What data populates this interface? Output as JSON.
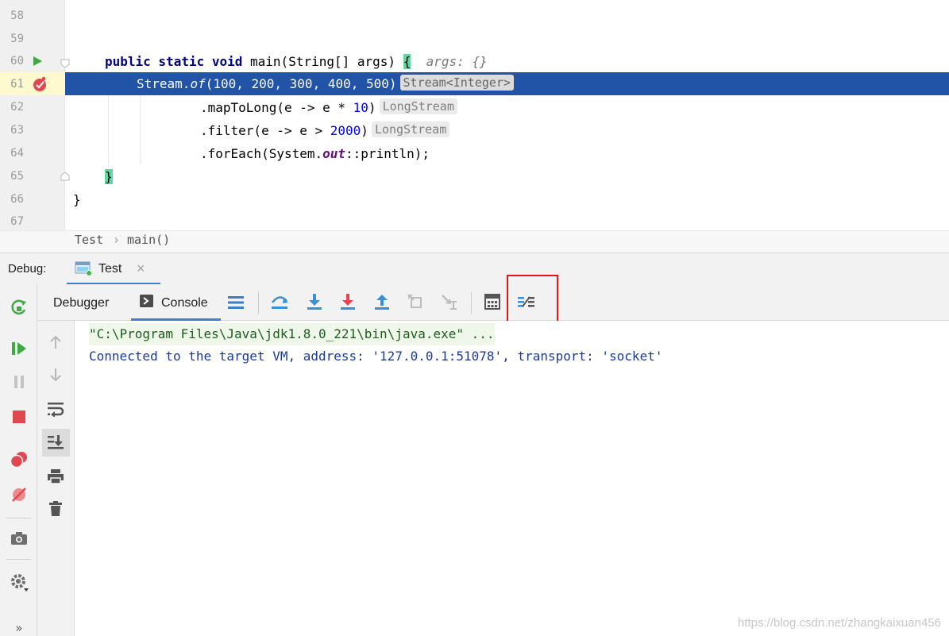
{
  "editor": {
    "lines": [
      {
        "num": "58"
      },
      {
        "num": "59"
      },
      {
        "num": "60"
      },
      {
        "num": "61"
      },
      {
        "num": "62"
      },
      {
        "num": "63"
      },
      {
        "num": "64"
      },
      {
        "num": "65"
      },
      {
        "num": "66"
      },
      {
        "num": "67"
      }
    ],
    "code": {
      "l60_kw": "public static void",
      "l60_rest": " main(String[] args) ",
      "l60_brace": "{",
      "l60_hint": "args: {}",
      "l61_a": "Stream.",
      "l61_of": "of",
      "l61_b": "(100, 200, 300, 400, 500)",
      "l61_inlay": "Stream<Integer>",
      "l62_a": ".mapToLong(e -> e * ",
      "l62_num": "10",
      "l62_b": ")",
      "l62_inlay": "LongStream",
      "l63_a": ".filter(e -> e > ",
      "l63_num": "2000",
      "l63_b": ")",
      "l63_inlay": "LongStream",
      "l64_a": ".forEach(System.",
      "l64_field": "out",
      "l64_b": "::println);",
      "l65": "}",
      "l66": "}"
    }
  },
  "breadcrumb": {
    "class": "Test",
    "method": "main()"
  },
  "debug": {
    "label": "Debug:",
    "session_tab": "Test",
    "tabs": {
      "debugger": "Debugger",
      "console": "Console"
    }
  },
  "console": {
    "line1": "\"C:\\Program Files\\Java\\jdk1.8.0_221\\bin\\java.exe\" ...",
    "line2": "Connected to the target VM, address: '127.0.0.1:51078', transport: 'socket'"
  },
  "watermark": "https://blog.csdn.net/zhangkaixuan456",
  "colors": {
    "exec_line": "#2154a6",
    "highlight_box": "#e0161b",
    "accent_blue": "#3a8fd6"
  }
}
